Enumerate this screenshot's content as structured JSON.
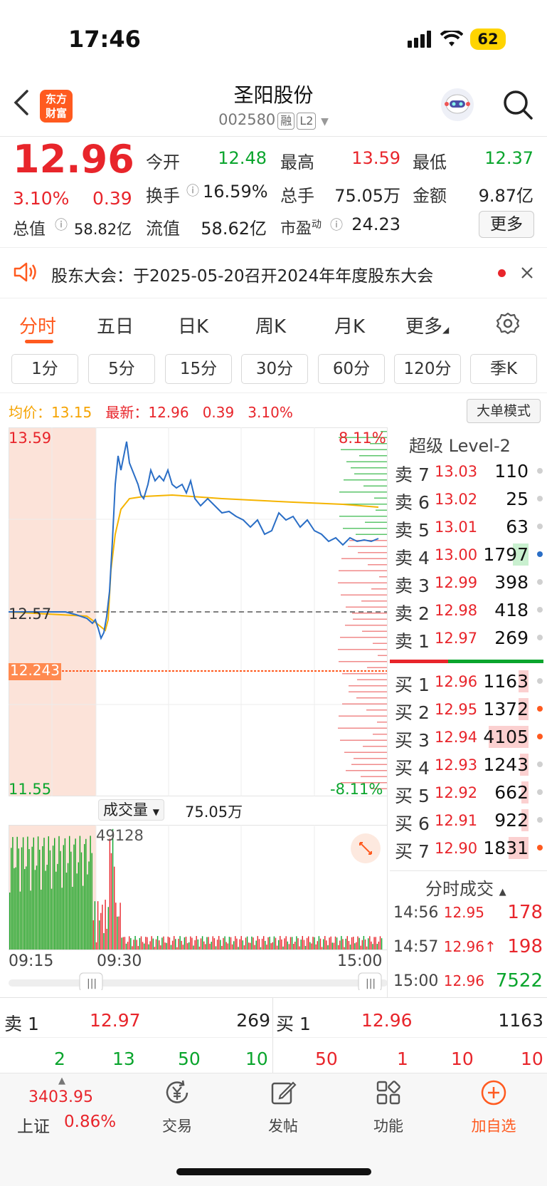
{
  "status_bar": {
    "time": "17:46",
    "battery": "62"
  },
  "header": {
    "title": "圣阳股份",
    "code": "002580",
    "tag_margin": "融",
    "tag_level": "L2",
    "logo_line1": "东方",
    "logo_line2": "财富"
  },
  "quote": {
    "price": "12.96",
    "change_pct": "3.10%",
    "change": "0.39",
    "total_cap_label": "总值",
    "total_cap": "58.82亿",
    "open_label": "今开",
    "open": "12.48",
    "high_label": "最高",
    "high": "13.59",
    "low_label": "最低",
    "low": "12.37",
    "turnover_label": "换手",
    "turnover": "16.59%",
    "volume_label": "总手",
    "volume": "75.05万",
    "amount_label": "金额",
    "amount": "9.87亿",
    "float_cap_label": "流值",
    "float_cap": "58.62亿",
    "pe_label": "市盈",
    "pe_sup": "动",
    "pe": "24.23",
    "more_button": "更多"
  },
  "notice": {
    "text": "股东大会：于2025-05-20召开2024年年度股东大会"
  },
  "period_tabs": [
    "分时",
    "五日",
    "日K",
    "周K",
    "月K",
    "更多"
  ],
  "interval_chips": [
    "1分",
    "5分",
    "15分",
    "30分",
    "60分",
    "120分",
    "季K"
  ],
  "info_line": {
    "avg_label": "均价：",
    "avg": "13.15",
    "latest_label": "最新：",
    "latest": "12.96",
    "chg": "0.39",
    "pct": "3.10%",
    "mode_button": "大单模式"
  },
  "chart": {
    "price_top": "13.59",
    "price_mid": "12.57",
    "price_bottom": "11.55",
    "pct_top": "8.11%",
    "pct_bottom": "-8.11%",
    "marker_price": "12.243",
    "volume_label": "成交量",
    "volume_total": "75.05万",
    "volume_peak": "49128",
    "time_start": "09:15",
    "time_mid": "09:30",
    "time_end": "15:00",
    "colors": {
      "price_line": "#2a6ec6",
      "avg_line": "#f5b400",
      "up": "#e8252b",
      "down": "#0aa52d",
      "premarket": "#fce3d9"
    }
  },
  "order_book": {
    "title": "超级 Level-2",
    "asks": [
      {
        "label": "卖 7",
        "price": "13.03",
        "vol": "110"
      },
      {
        "label": "卖 6",
        "price": "13.02",
        "vol": "25"
      },
      {
        "label": "卖 5",
        "price": "13.01",
        "vol": "63"
      },
      {
        "label": "卖 4",
        "price": "13.00",
        "vol": "1797"
      },
      {
        "label": "卖 3",
        "price": "12.99",
        "vol": "398"
      },
      {
        "label": "卖 2",
        "price": "12.98",
        "vol": "418"
      },
      {
        "label": "卖 1",
        "price": "12.97",
        "vol": "269"
      }
    ],
    "bids": [
      {
        "label": "买 1",
        "price": "12.96",
        "vol": "1163"
      },
      {
        "label": "买 2",
        "price": "12.95",
        "vol": "1372"
      },
      {
        "label": "买 3",
        "price": "12.94",
        "vol": "4105"
      },
      {
        "label": "买 4",
        "price": "12.93",
        "vol": "1243"
      },
      {
        "label": "买 5",
        "price": "12.92",
        "vol": "662"
      },
      {
        "label": "买 6",
        "price": "12.91",
        "vol": "922"
      },
      {
        "label": "买 7",
        "price": "12.90",
        "vol": "1831"
      }
    ]
  },
  "ticks": {
    "title": "分时成交",
    "rows": [
      {
        "time": "14:56",
        "price": "12.95",
        "vol": "178"
      },
      {
        "time": "14:57",
        "price": "12.96↑",
        "vol": "198"
      },
      {
        "time": "15:00",
        "price": "12.96",
        "vol": "7522"
      }
    ]
  },
  "bottom_quote": {
    "ask_label": "卖 1",
    "ask_price": "12.97",
    "ask_vol": "269",
    "bid_label": "买 1",
    "bid_price": "12.96",
    "bid_vol": "1163",
    "left_nums": [
      "2",
      "13",
      "50",
      "10"
    ],
    "right_nums": [
      "50",
      "1",
      "10",
      "10"
    ]
  },
  "tab_bar": {
    "index_value": "3403.95",
    "index_name": "上证",
    "index_pct": "0.86%",
    "trade": "交易",
    "post": "发帖",
    "functions": "功能",
    "add": "加自选"
  }
}
